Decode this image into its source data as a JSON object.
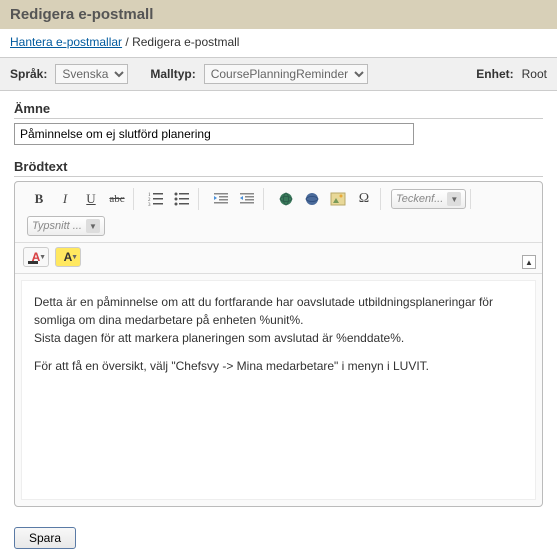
{
  "header": {
    "title": "Redigera e-postmall"
  },
  "breadcrumb": {
    "link_text": "Hantera e-postmallar",
    "separator": " / ",
    "current": "Redigera e-postmall"
  },
  "filters": {
    "language_label": "Språk:",
    "language_value": "Svenska",
    "template_type_label": "Malltyp:",
    "template_type_value": "CoursePlanningReminder",
    "unit_label": "Enhet:",
    "unit_value": "Root"
  },
  "subject": {
    "label": "Ämne",
    "value": "Påminnelse om ej slutförd planering"
  },
  "body": {
    "label": "Brödtext",
    "paragraphs": [
      "Detta är en påminnelse om att du fortfarande har oavslutade utbildningsplaneringar för somliga om dina medarbetare på enheten %unit%.",
      "Sista dagen för att markera planeringen som avslutad är %enddate%.",
      "För att få en översikt, välj \"Chefsvy -> Mina medarbetare\" i menyn i LUVIT."
    ]
  },
  "toolbar": {
    "font_family_label": "Teckenf...",
    "font_size_label": "Typsnitt ..."
  },
  "actions": {
    "save": "Spara"
  }
}
